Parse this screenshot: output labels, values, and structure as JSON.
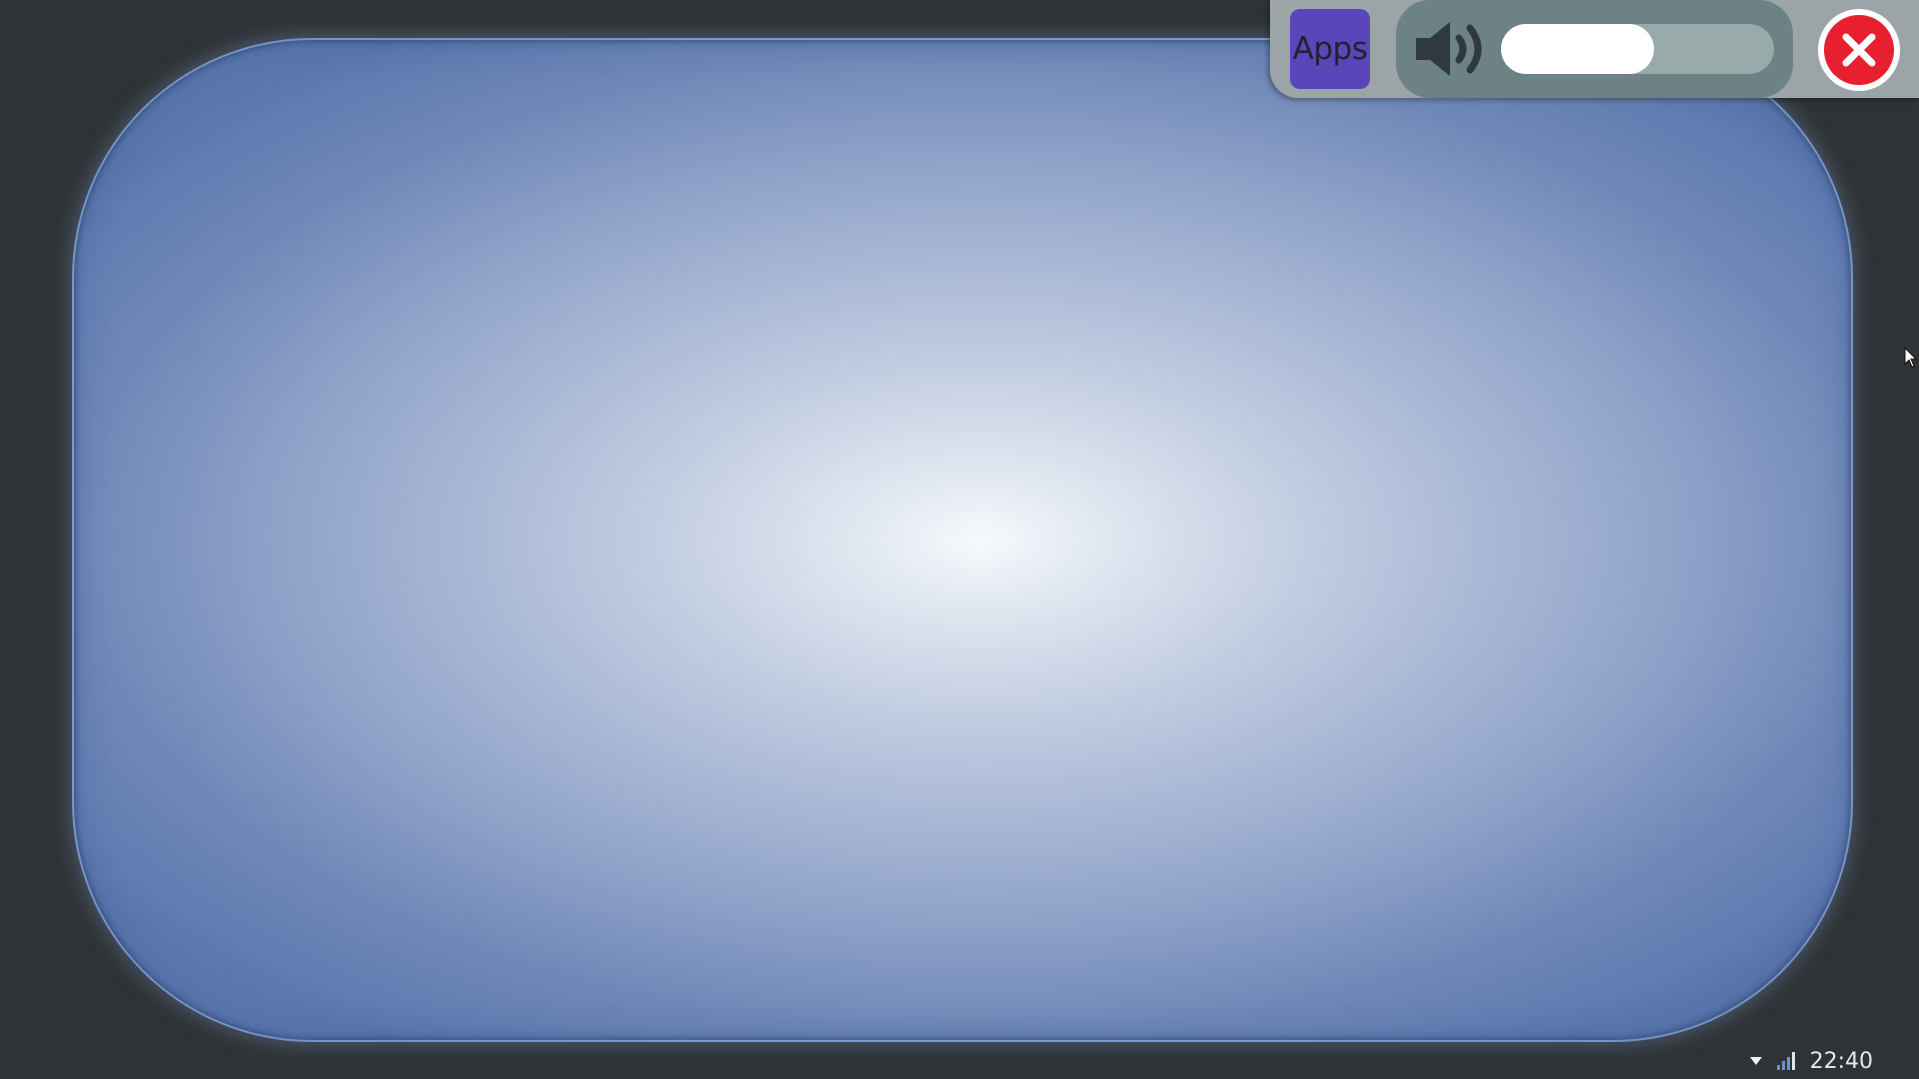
{
  "top_bar": {
    "apps_label": "Apps",
    "volume": {
      "icon": "speaker-icon",
      "level": 0.56
    },
    "close_icon": "close-icon"
  },
  "panel": {
    "colors": {
      "center": "#f7f9fc",
      "edge": "#5a77ad"
    }
  },
  "tray": {
    "notification_icon": "dropdown-arrow-icon",
    "signal_icon": "signal-bars-icon",
    "clock": "22:40"
  },
  "colors": {
    "desktop_bg": "#2f3335",
    "apps_button": "#5b46b9",
    "close_button": "#e81f2e",
    "volume_group": "#6c8284"
  }
}
